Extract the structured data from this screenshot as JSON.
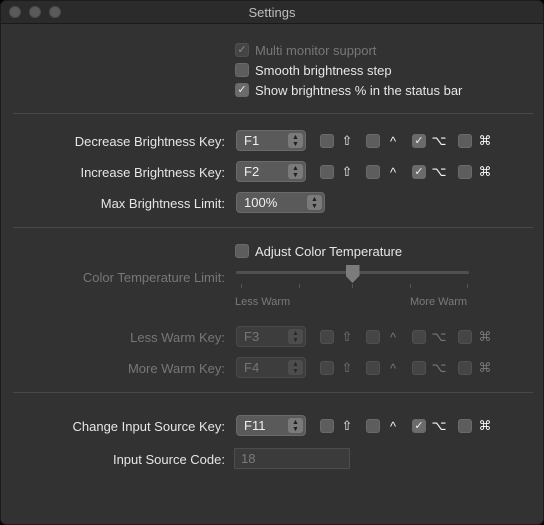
{
  "window": {
    "title": "Settings"
  },
  "general": {
    "multi_monitor": {
      "label": "Multi monitor support",
      "checked": true,
      "enabled": false
    },
    "smooth_step": {
      "label": "Smooth brightness step",
      "checked": false
    },
    "show_percent": {
      "label": "Show brightness % in the status bar",
      "checked": true
    }
  },
  "brightness": {
    "decrease": {
      "label": "Decrease Brightness Key:",
      "key": "F1",
      "shift": false,
      "control": false,
      "option": true,
      "command": false
    },
    "increase": {
      "label": "Increase Brightness Key:",
      "key": "F2",
      "shift": false,
      "control": false,
      "option": true,
      "command": false
    },
    "max_limit": {
      "label": "Max Brightness Limit:",
      "value": "100%"
    }
  },
  "color_temp": {
    "adjust": {
      "label": "Adjust Color Temperature",
      "checked": false
    },
    "limit_label": "Color Temperature Limit:",
    "limit_value_fraction": 0.5,
    "less_warm_label": "Less Warm",
    "more_warm_label": "More Warm",
    "less_warm_key": {
      "label": "Less Warm Key:",
      "key": "F3",
      "shift": false,
      "control": false,
      "option": false,
      "command": false
    },
    "more_warm_key": {
      "label": "More Warm Key:",
      "key": "F4",
      "shift": false,
      "control": false,
      "option": false,
      "command": false
    }
  },
  "input_source": {
    "key": {
      "label": "Change Input Source Key:",
      "key": "F11",
      "shift": false,
      "control": false,
      "option": true,
      "command": false
    },
    "code": {
      "label": "Input Source Code:",
      "value": "18"
    }
  },
  "glyphs": {
    "shift": "⇧",
    "control": "^",
    "option": "⌥",
    "command": "⌘",
    "check": "✓",
    "up": "▲",
    "down": "▼"
  }
}
